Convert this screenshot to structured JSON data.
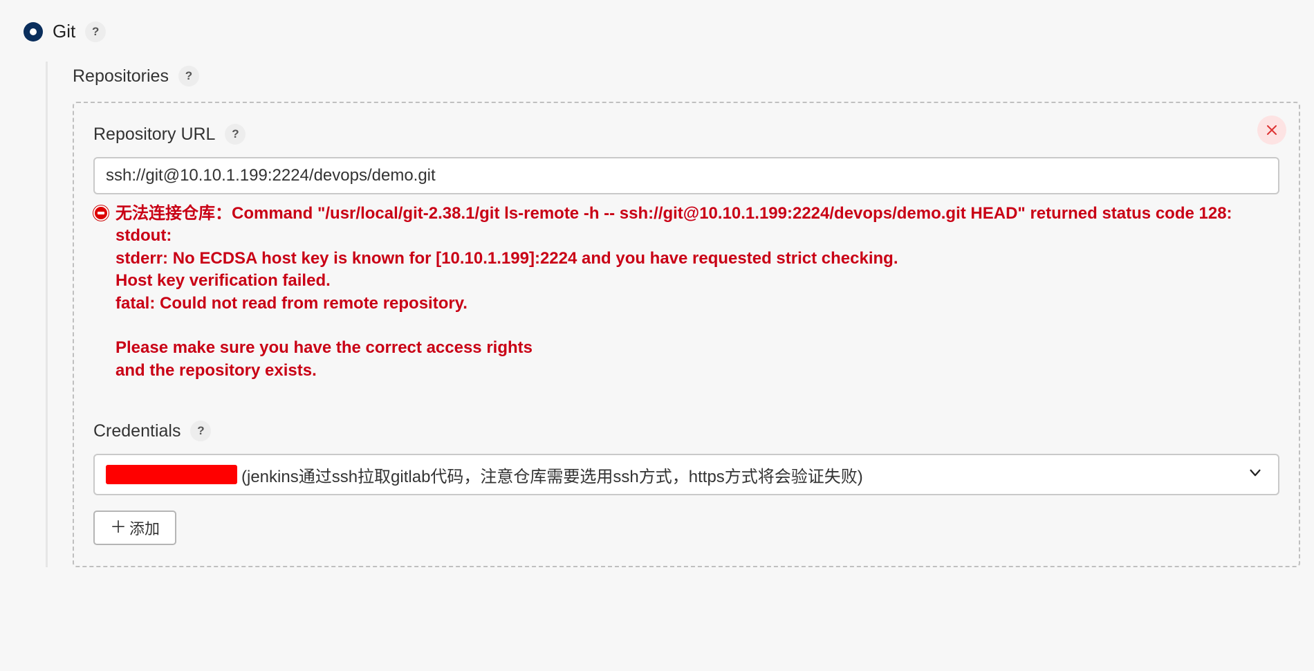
{
  "scm": {
    "option_label": "Git",
    "repositories_label": "Repositories",
    "repo": {
      "url_label": "Repository URL",
      "url_value": "ssh://git@10.10.1.199:2224/devops/demo.git",
      "error": "无法连接仓库：Command \"/usr/local/git-2.38.1/git ls-remote -h -- ssh://git@10.10.1.199:2224/devops/demo.git HEAD\" returned status code 128:\nstdout:\nstderr: No ECDSA host key is known for [10.10.1.199]:2224 and you have requested strict checking.\nHost key verification failed.\nfatal: Could not read from remote repository.\n\nPlease make sure you have the correct access rights\nand the repository exists.",
      "credentials_label": "Credentials",
      "credentials_selected": "(jenkins通过ssh拉取gitlab代码，注意仓库需要选用ssh方式，https方式将会验证失败)",
      "add_button": "添加"
    }
  },
  "help_glyph": "?"
}
